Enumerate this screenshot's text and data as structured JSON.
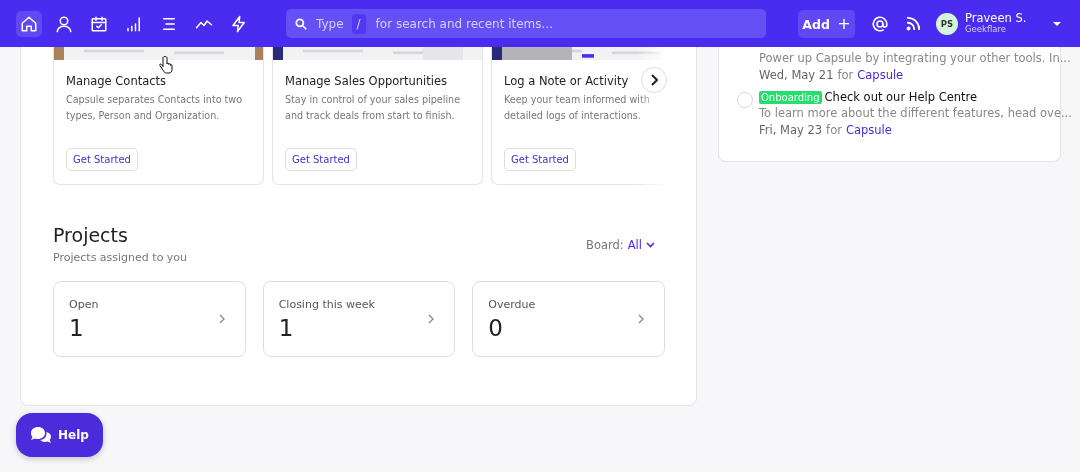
{
  "nav": {
    "icons": [
      {
        "selected": true
      },
      {
        "selected": false
      },
      {
        "selected": false
      },
      {
        "selected": false
      },
      {
        "selected": false
      },
      {
        "selected": false
      },
      {
        "selected": false
      }
    ],
    "search": {
      "placeholder_start": "Type",
      "shortcut": "/",
      "placeholder": "for search and recent items..."
    },
    "add_button": "Add",
    "add_icon": "+",
    "user": {
      "initials": "PS",
      "name": "Praveen S.",
      "org": "Geekflare"
    }
  },
  "guides": [
    {
      "title": "Manage Contacts",
      "description": "Capsule separates Contacts into two types, Person and Organization.",
      "button": "Get Started"
    },
    {
      "title": "Manage Sales Opportunities",
      "description": "Stay in control of your sales pipeline and track deals from start to finish.",
      "button": "Get Started"
    },
    {
      "title": "Log a Note or Activity",
      "description": "Keep your team informed with detailed logs of interactions.",
      "button": "Get Started"
    }
  ],
  "projects": {
    "title": "Projects",
    "subtitle": "Projects assigned to you",
    "board_label": "Board:",
    "board_value": "All",
    "stats": [
      {
        "label": "Open",
        "value": "1"
      },
      {
        "label": "Closing this week",
        "value": "1"
      },
      {
        "label": "Overdue",
        "value": "0"
      }
    ]
  },
  "tasks": [
    {
      "kind": "partial",
      "description": "Power up Capsule by integrating your other tools. In...",
      "date": "Wed, May 21",
      "for": "for",
      "link": "Capsule"
    },
    {
      "kind": "full",
      "checked": false,
      "tag": {
        "label": "Onboarding",
        "color": "#22e06b"
      },
      "title": "Check out our Help Centre",
      "description": "To learn more about the different features, head ove...",
      "date": "Fri, May 23",
      "for": "for",
      "link": "Capsule"
    }
  ],
  "help_button": "Help"
}
